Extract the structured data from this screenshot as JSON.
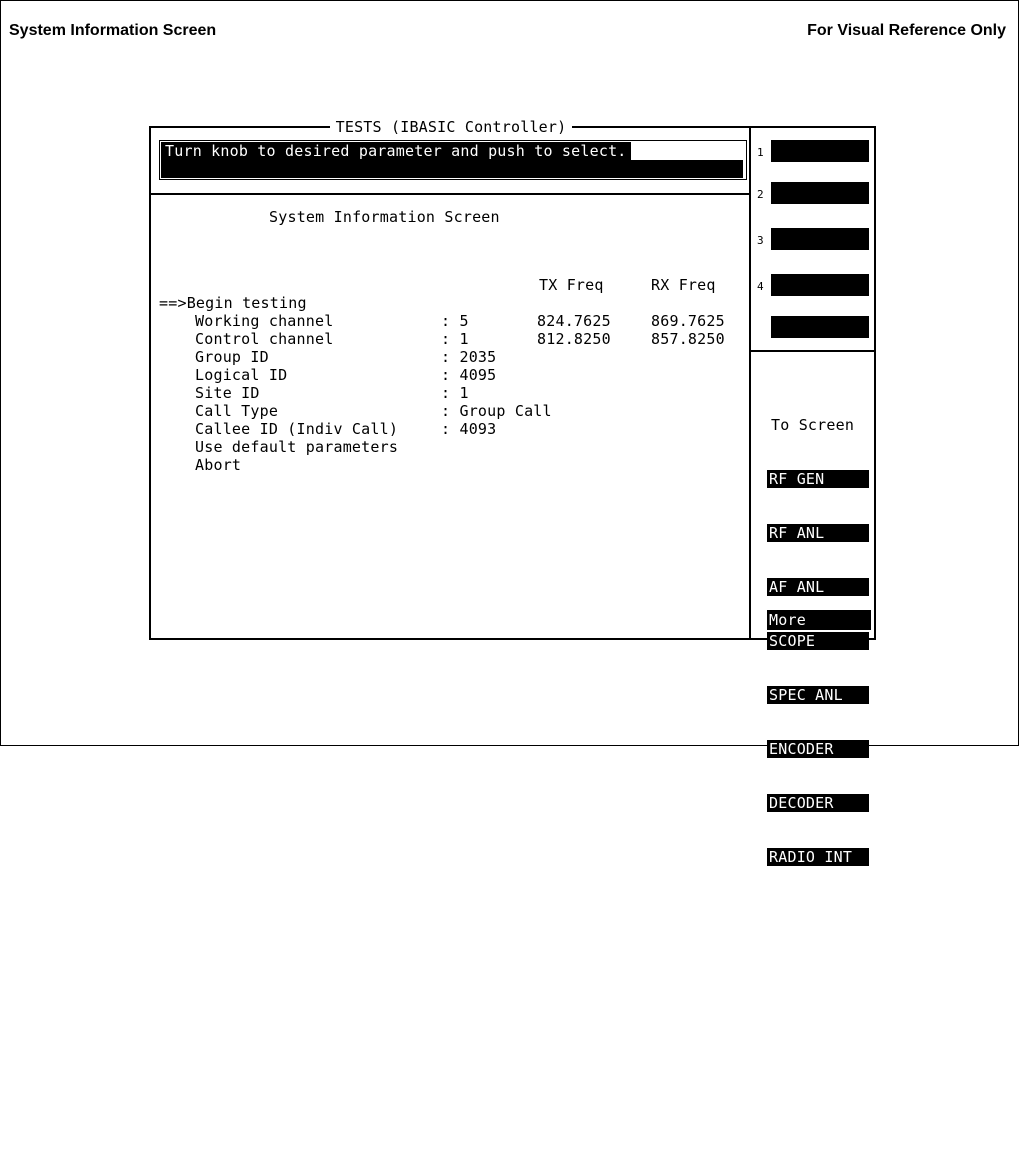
{
  "header": {
    "left": "System Information Screen",
    "right": "For Visual Reference Only"
  },
  "screen": {
    "title": "TESTS (IBASIC Controller)",
    "prompt": "Turn knob to desired parameter and push to select.",
    "heading": "System Information Screen",
    "col_tx": "TX Freq",
    "col_rx": "RX Freq",
    "begin": "==>Begin testing",
    "rows": [
      {
        "label": "Working channel      ",
        "value": ": 5",
        "tx": "824.7625",
        "rx": "869.7625"
      },
      {
        "label": "Control channel      ",
        "value": ": 1",
        "tx": "812.8250",
        "rx": "857.8250"
      },
      {
        "label": "Group ID             ",
        "value": ": 2035",
        "tx": "",
        "rx": ""
      },
      {
        "label": "Logical ID           ",
        "value": ": 4095",
        "tx": "",
        "rx": ""
      },
      {
        "label": "Site ID              ",
        "value": ": 1",
        "tx": "",
        "rx": ""
      },
      {
        "label": "Call Type            ",
        "value": ": Group Call",
        "tx": "",
        "rx": ""
      },
      {
        "label": "Callee ID (Indiv Call)",
        "value": ": 4093",
        "tx": "",
        "rx": ""
      }
    ],
    "use_default": "Use default parameters",
    "abort": "Abort"
  },
  "fkeys": {
    "labels": [
      "1",
      "2",
      "3",
      "4"
    ]
  },
  "to_screen": {
    "title": "To Screen",
    "items": [
      "RF GEN",
      "RF ANL",
      "AF ANL",
      "SCOPE",
      "SPEC ANL",
      "ENCODER",
      "DECODER",
      "RADIO INT"
    ],
    "more": "More"
  }
}
